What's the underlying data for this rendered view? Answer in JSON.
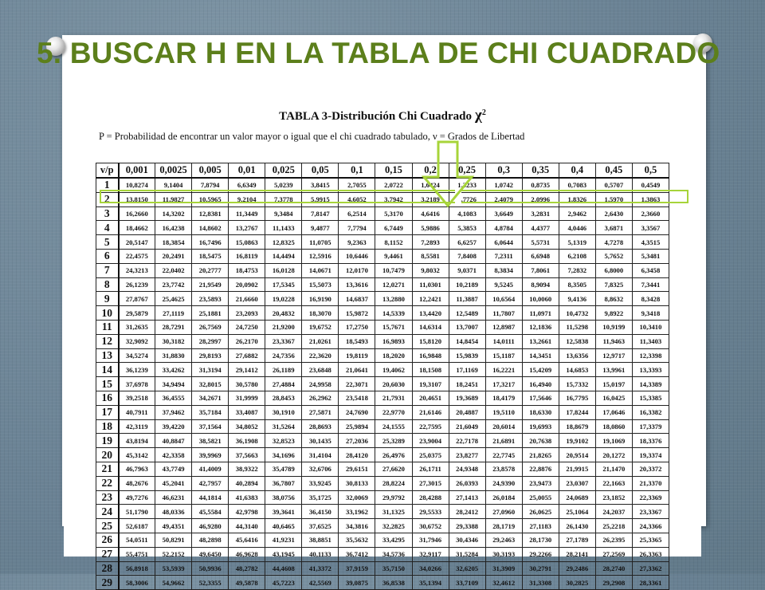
{
  "slide": {
    "title": "5. BUSCAR H EN LA TABLA DE CHI CUADRADO",
    "colors": {
      "title": "#5c7f1b",
      "highlight": "#a7d43a",
      "background": "#6f8798"
    }
  },
  "table": {
    "title": "TABLA 3-Distribución Chi Cuadrado",
    "chi_symbol": "χ",
    "chi_superscript": "2",
    "subtitle": "P = Probabilidad de encontrar un valor mayor o igual que el chi cuadrado tabulado, ν = Grados de Libertad",
    "headers": [
      "v/p",
      "0,001",
      "0,0025",
      "0,005",
      "0,01",
      "0,025",
      "0,05",
      "0,1",
      "0,15",
      "0,2",
      "0,25",
      "0,3",
      "0,35",
      "0,4",
      "0,45",
      "0,5"
    ],
    "highlighted_row": "2",
    "highlighted_column": "0,2",
    "rows": [
      [
        "1",
        "10,8274",
        "9,1404",
        "7,8794",
        "6,6349",
        "5,0239",
        "3,8415",
        "2,7055",
        "2,0722",
        "1,6424",
        "1,3233",
        "1,0742",
        "0,8735",
        "0,7083",
        "0,5707",
        "0,4549"
      ],
      [
        "2",
        "13,8150",
        "11,9827",
        "10,5965",
        "9,2104",
        "7,3778",
        "5,9915",
        "4,6052",
        "3,7942",
        "3,2189",
        "2,7726",
        "2,4079",
        "2,0996",
        "1,8326",
        "1,5970",
        "1,3863"
      ],
      [
        "3",
        "16,2660",
        "14,3202",
        "12,8381",
        "11,3449",
        "9,3484",
        "7,8147",
        "6,2514",
        "5,3170",
        "4,6416",
        "4,1083",
        "3,6649",
        "3,2831",
        "2,9462",
        "2,6430",
        "2,3660"
      ],
      [
        "4",
        "18,4662",
        "16,4238",
        "14,8602",
        "13,2767",
        "11,1433",
        "9,4877",
        "7,7794",
        "6,7449",
        "5,9886",
        "5,3853",
        "4,8784",
        "4,4377",
        "4,0446",
        "3,6871",
        "3,3567"
      ],
      [
        "5",
        "20,5147",
        "18,3854",
        "16,7496",
        "15,0863",
        "12,8325",
        "11,0705",
        "9,2363",
        "8,1152",
        "7,2893",
        "6,6257",
        "6,0644",
        "5,5731",
        "5,1319",
        "4,7278",
        "4,3515"
      ],
      [
        "6",
        "22,4575",
        "20,2491",
        "18,5475",
        "16,8119",
        "14,4494",
        "12,5916",
        "10,6446",
        "9,4461",
        "8,5581",
        "7,8408",
        "7,2311",
        "6,6948",
        "6,2108",
        "5,7652",
        "5,3481"
      ],
      [
        "7",
        "24,3213",
        "22,0402",
        "20,2777",
        "18,4753",
        "16,0128",
        "14,0671",
        "12,0170",
        "10,7479",
        "9,8032",
        "9,0371",
        "8,3834",
        "7,8061",
        "7,2832",
        "6,8000",
        "6,3458"
      ],
      [
        "8",
        "26,1239",
        "23,7742",
        "21,9549",
        "20,0902",
        "17,5345",
        "15,5073",
        "13,3616",
        "12,0271",
        "11,0301",
        "10,2189",
        "9,5245",
        "8,9094",
        "8,3505",
        "7,8325",
        "7,3441"
      ],
      [
        "9",
        "27,8767",
        "25,4625",
        "23,5893",
        "21,6660",
        "19,0228",
        "16,9190",
        "14,6837",
        "13,2880",
        "12,2421",
        "11,3887",
        "10,6564",
        "10,0060",
        "9,4136",
        "8,8632",
        "8,3428"
      ],
      [
        "10",
        "29,5879",
        "27,1119",
        "25,1881",
        "23,2093",
        "20,4832",
        "18,3070",
        "15,9872",
        "14,5339",
        "13,4420",
        "12,5489",
        "11,7807",
        "11,0971",
        "10,4732",
        "9,8922",
        "9,3418"
      ],
      [
        "11",
        "31,2635",
        "28,7291",
        "26,7569",
        "24,7250",
        "21,9200",
        "19,6752",
        "17,2750",
        "15,7671",
        "14,6314",
        "13,7007",
        "12,8987",
        "12,1836",
        "11,5298",
        "10,9199",
        "10,3410"
      ],
      [
        "12",
        "32,9092",
        "30,3182",
        "28,2997",
        "26,2170",
        "23,3367",
        "21,0261",
        "18,5493",
        "16,9893",
        "15,8120",
        "14,8454",
        "14,0111",
        "13,2661",
        "12,5838",
        "11,9463",
        "11,3403"
      ],
      [
        "13",
        "34,5274",
        "31,8830",
        "29,8193",
        "27,6882",
        "24,7356",
        "22,3620",
        "19,8119",
        "18,2020",
        "16,9848",
        "15,9839",
        "15,1187",
        "14,3451",
        "13,6356",
        "12,9717",
        "12,3398"
      ],
      [
        "14",
        "36,1239",
        "33,4262",
        "31,3194",
        "29,1412",
        "26,1189",
        "23,6848",
        "21,0641",
        "19,4062",
        "18,1508",
        "17,1169",
        "16,2221",
        "15,4209",
        "14,6853",
        "13,9961",
        "13,3393"
      ],
      [
        "15",
        "37,6978",
        "34,9494",
        "32,8015",
        "30,5780",
        "27,4884",
        "24,9958",
        "22,3071",
        "20,6030",
        "19,3107",
        "18,2451",
        "17,3217",
        "16,4940",
        "15,7332",
        "15,0197",
        "14,3389"
      ],
      [
        "16",
        "39,2518",
        "36,4555",
        "34,2671",
        "31,9999",
        "28,8453",
        "26,2962",
        "23,5418",
        "21,7931",
        "20,4651",
        "19,3689",
        "18,4179",
        "17,5646",
        "16,7795",
        "16,0425",
        "15,3385"
      ],
      [
        "17",
        "40,7911",
        "37,9462",
        "35,7184",
        "33,4087",
        "30,1910",
        "27,5871",
        "24,7690",
        "22,9770",
        "21,6146",
        "20,4887",
        "19,5110",
        "18,6330",
        "17,8244",
        "17,0646",
        "16,3382"
      ],
      [
        "18",
        "42,3119",
        "39,4220",
        "37,1564",
        "34,8052",
        "31,5264",
        "28,8693",
        "25,9894",
        "24,1555",
        "22,7595",
        "21,6049",
        "20,6014",
        "19,6993",
        "18,8679",
        "18,0860",
        "17,3379"
      ],
      [
        "19",
        "43,8194",
        "40,8847",
        "38,5821",
        "36,1908",
        "32,8523",
        "30,1435",
        "27,2036",
        "25,3289",
        "23,9004",
        "22,7178",
        "21,6891",
        "20,7638",
        "19,9102",
        "19,1069",
        "18,3376"
      ],
      [
        "20",
        "45,3142",
        "42,3358",
        "39,9969",
        "37,5663",
        "34,1696",
        "31,4104",
        "28,4120",
        "26,4976",
        "25,0375",
        "23,8277",
        "22,7745",
        "21,8265",
        "20,9514",
        "20,1272",
        "19,3374"
      ],
      [
        "21",
        "46,7963",
        "43,7749",
        "41,4009",
        "38,9322",
        "35,4789",
        "32,6706",
        "29,6151",
        "27,6620",
        "26,1711",
        "24,9348",
        "23,8578",
        "22,8876",
        "21,9915",
        "21,1470",
        "20,3372"
      ],
      [
        "22",
        "48,2676",
        "45,2041",
        "42,7957",
        "40,2894",
        "36,7807",
        "33,9245",
        "30,8133",
        "28,8224",
        "27,3015",
        "26,0393",
        "24,9390",
        "23,9473",
        "23,0307",
        "22,1663",
        "21,3370"
      ],
      [
        "23",
        "49,7276",
        "46,6231",
        "44,1814",
        "41,6383",
        "38,0756",
        "35,1725",
        "32,0069",
        "29,9792",
        "28,4288",
        "27,1413",
        "26,0184",
        "25,0055",
        "24,0689",
        "23,1852",
        "22,3369"
      ],
      [
        "24",
        "51,1790",
        "48,0336",
        "45,5584",
        "42,9798",
        "39,3641",
        "36,4150",
        "33,1962",
        "31,1325",
        "29,5533",
        "28,2412",
        "27,0960",
        "26,0625",
        "25,1064",
        "24,2037",
        "23,3367"
      ],
      [
        "25",
        "52,6187",
        "49,4351",
        "46,9280",
        "44,3140",
        "40,6465",
        "37,6525",
        "34,3816",
        "32,2825",
        "30,6752",
        "29,3388",
        "28,1719",
        "27,1183",
        "26,1430",
        "25,2218",
        "24,3366"
      ],
      [
        "26",
        "54,0511",
        "50,8291",
        "48,2898",
        "45,6416",
        "41,9231",
        "38,8851",
        "35,5632",
        "33,4295",
        "31,7946",
        "30,4346",
        "29,2463",
        "28,1730",
        "27,1789",
        "26,2395",
        "25,3365"
      ],
      [
        "27",
        "55,4751",
        "52,2152",
        "49,6450",
        "46,9628",
        "43,1945",
        "40,1133",
        "36,7412",
        "34,5736",
        "32,9117",
        "31,5284",
        "30,3193",
        "29,2266",
        "28,2141",
        "27,2569",
        "26,3363"
      ],
      [
        "28",
        "56,8918",
        "53,5939",
        "50,9936",
        "48,2782",
        "44,4608",
        "41,3372",
        "37,9159",
        "35,7150",
        "34,0266",
        "32,6205",
        "31,3909",
        "30,2791",
        "29,2486",
        "28,2740",
        "27,3362"
      ],
      [
        "29",
        "58,3006",
        "54,9662",
        "52,3355",
        "49,5878",
        "45,7223",
        "42,5569",
        "39,0875",
        "36,8538",
        "35,1394",
        "33,7109",
        "32,4612",
        "31,3308",
        "30,2825",
        "29,2908",
        "28,3361"
      ]
    ]
  }
}
